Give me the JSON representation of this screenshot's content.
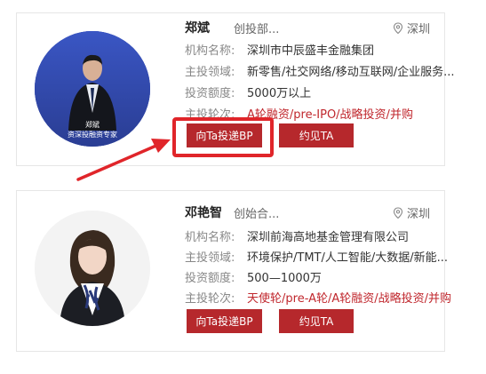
{
  "investors": [
    {
      "name": "郑斌",
      "role": "创投部...",
      "location": "深圳",
      "photo_caption": [
        "郑斌",
        "资深投融资专家"
      ],
      "fields": [
        {
          "label": "机构名称:",
          "value": "深圳市中辰盛丰金融集团"
        },
        {
          "label": "主投领域:",
          "value": "新零售/社交网络/移动互联网/企业服务..."
        },
        {
          "label": "投资额度:",
          "value": "5000万以上"
        },
        {
          "label": "主投轮次:",
          "value": "A轮融资/pre-IPO/战略投资/并购"
        }
      ],
      "primary_button": "向Ta投递BP",
      "secondary_button": "约见TA"
    },
    {
      "name": "邓艳智",
      "role": "创始合...",
      "location": "深圳",
      "fields": [
        {
          "label": "机构名称:",
          "value": "深圳前海高地基金管理有限公司"
        },
        {
          "label": "主投领域:",
          "value": "环境保护/TMT/人工智能/大数据/新能..."
        },
        {
          "label": "投资额度:",
          "value": "500—1000万"
        },
        {
          "label": "主投轮次:",
          "value": "天使轮/pre-A轮/A轮融资/战略投资/并购"
        }
      ],
      "primary_button": "向Ta投递BP",
      "secondary_button": "约见TA"
    }
  ],
  "colors": {
    "accent": "#b6282c",
    "highlight": "#e0252a"
  },
  "icons": {
    "location": "location-pin-icon"
  }
}
